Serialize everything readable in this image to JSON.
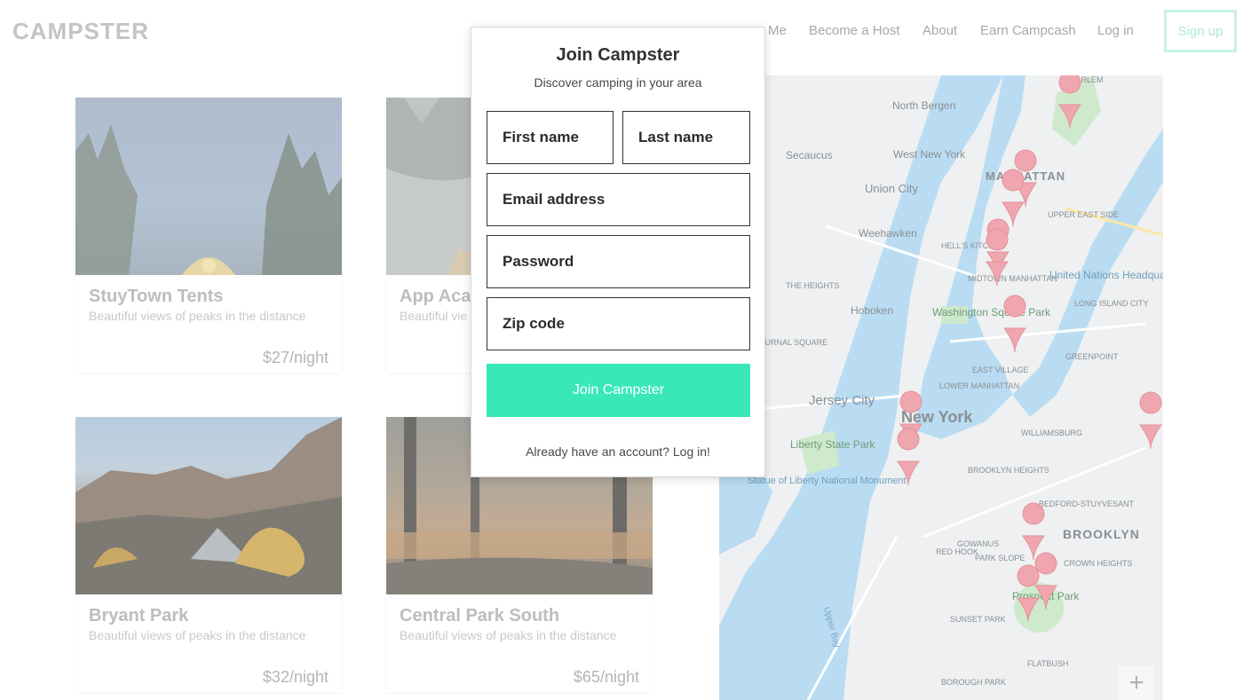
{
  "header": {
    "logo": "CAMPSTER",
    "nav": [
      "Me",
      "Become a Host",
      "About",
      "Earn Campcash",
      "Log in"
    ],
    "signup": "Sign up"
  },
  "listings": [
    {
      "title": "StuyTown Tents",
      "desc": "Beautiful views of peaks in the distance",
      "price": "$27/night"
    },
    {
      "title": "App Aca",
      "desc": "Beautiful vie",
      "price": ""
    },
    {
      "title": "Bryant Park",
      "desc": "Beautiful views of peaks in the distance",
      "price": "$32/night"
    },
    {
      "title": "Central Park South",
      "desc": "Beautiful views of peaks in the distance",
      "price": "$65/night"
    }
  ],
  "modal": {
    "title": "Join Campster",
    "subtitle": "Discover camping in your area",
    "fields": {
      "first_name": "First name",
      "last_name": "Last name",
      "email": "Email address",
      "password": "Password",
      "zip": "Zip code"
    },
    "submit": "Join Campster",
    "footer": "Already have an account? Log in!"
  },
  "map": {
    "labels": [
      "North Bergen",
      "Secaucus",
      "West New York",
      "Union City",
      "MANHATTAN",
      "UPPER EAST SIDE",
      "Weehawken",
      "HELL'S KITCHEN",
      "MIDTOWN MANHATTAN",
      "United Nations Headquarters",
      "THE HEIGHTS",
      "Hoboken",
      "Washington Square Park",
      "LONG ISLAND CITY",
      "JOURNAL SQUARE",
      "EAST VILLAGE",
      "GREENPOINT",
      "LOWER MANHATTAN",
      "Jersey City",
      "New York",
      "WILLIAMSBURG",
      "Liberty State Park",
      "Statue of Liberty National Monument",
      "BROOKLYN HEIGHTS",
      "BEDFORD-STUYVESANT",
      "RED HOOK",
      "GOWANUS",
      "PARK SLOPE",
      "BROOKLYN",
      "CROWN HEIGHTS",
      "Prospect Park",
      "SUNSET PARK",
      "FLATBUSH",
      "BOROUGH PARK",
      "Upper Bay",
      "HARLEM"
    ],
    "zoom_label": "+",
    "pin_color": "#f0a6ae",
    "water_color": "#b9dcf2",
    "park_color": "#cfe9cc"
  }
}
